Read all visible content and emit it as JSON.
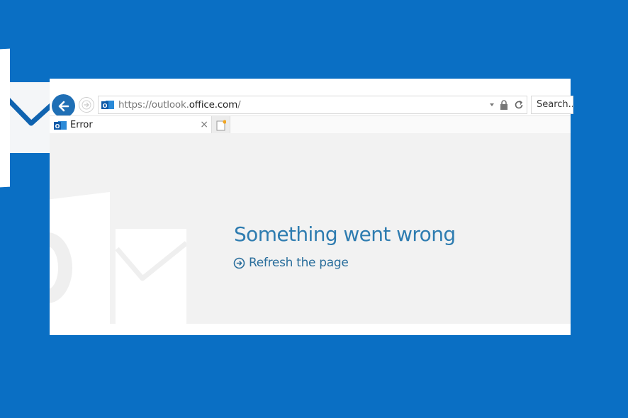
{
  "browser": {
    "address_bar": {
      "url_prefix": "https://outlook.",
      "url_domain": "office.com",
      "url_suffix": "/"
    },
    "search": {
      "placeholder": "Search..."
    },
    "tabs": [
      {
        "title": "Error",
        "close_glyph": "×",
        "icon": "outlook-icon"
      }
    ]
  },
  "page": {
    "error_title": "Something went wrong",
    "refresh_link_label": "Refresh the page"
  },
  "colors": {
    "background_blue": "#0a6fc4",
    "back_button": "#1f6fb5",
    "error_title": "#2e7cb0",
    "link": "#2a6e9c",
    "content_bg": "#f2f2f2"
  }
}
